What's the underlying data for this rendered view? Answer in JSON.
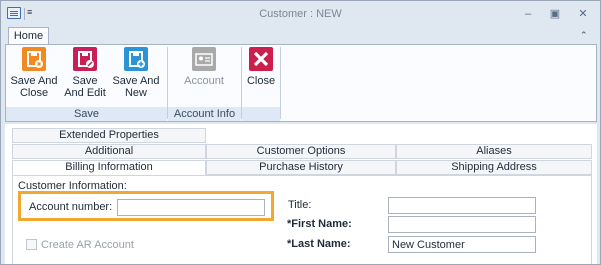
{
  "window": {
    "title": "Customer : NEW",
    "qat_dropdown": "≡",
    "minimize": "‒",
    "maximize": "▣",
    "close": "✕"
  },
  "ribbon": {
    "home_tab": "Home",
    "collapse": "⌃",
    "save_group": {
      "label": "Save",
      "buttons": [
        {
          "line1": "Save And",
          "line2": "Close",
          "icon": "save-close-icon",
          "color": "#f28a21"
        },
        {
          "line1": "Save",
          "line2": "And Edit",
          "icon": "save-edit-icon",
          "color": "#c81f56"
        },
        {
          "line1": "Save And",
          "line2": "New",
          "icon": "save-new-icon",
          "color": "#2a94d6"
        }
      ]
    },
    "account_group": {
      "label": "Account Info",
      "button": {
        "label": "Account",
        "icon": "account-card-icon",
        "color": "#a9a9a9",
        "disabled": true
      }
    },
    "close_group": {
      "button": {
        "label": "Close",
        "icon": "close-x-icon",
        "color": "#cc1f4c"
      }
    }
  },
  "tabs": {
    "row1": [
      "Extended Properties"
    ],
    "row2": [
      "Additional",
      "Customer Options",
      "Aliases"
    ],
    "row3": [
      "Billing Information",
      "Purchase History",
      "Shipping Address"
    ],
    "active": "Billing Information"
  },
  "form": {
    "section_label": "Customer Information:",
    "account_number_label": "Account number:",
    "account_number_value": "",
    "create_ar_label": "Create AR Account",
    "title_label": "Title:",
    "title_value": "",
    "first_name_label": "*First Name:",
    "first_name_value": "",
    "last_name_label": "*Last Name:",
    "last_name_value": "New Customer"
  },
  "colors": {
    "highlight": "#f0a830",
    "ribbon_bg": "#fafcff",
    "window_bg": "#dfe7f1"
  }
}
